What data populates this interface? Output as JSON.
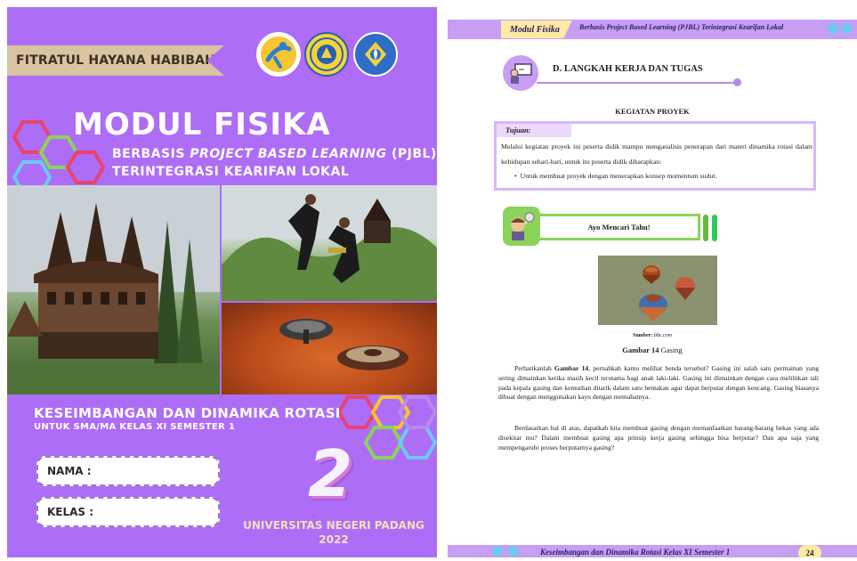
{
  "cover": {
    "author": "FITRATUL HAYANA HABIBAH",
    "title": "MODUL FISIKA",
    "subtitle_line1_prefix": "BERBASIS ",
    "subtitle_line1_italic": "PROJECT BASED LEARNING",
    "subtitle_line1_suffix": " (PJBL)",
    "subtitle_line2": "TERINTEGRASI KEARIFAN LOKAL",
    "topic": "KESEIMBANGAN DAN DINAMIKA ROTASI",
    "audience": "UNTUK SMA/MA KELAS XI SEMESTER 1",
    "nama_label": "NAMA :",
    "kelas_label": "KELAS :",
    "module_number": "2",
    "university": "UNIVERSITAS NEGERI PADANG",
    "year": "2022",
    "colors": {
      "background": "#ad6df6",
      "ribbon": "#d9c4a2",
      "university_text": "#f4dfc0"
    }
  },
  "page": {
    "header_tag": "Modul Fisika",
    "header_text": "Berbasis Project Based Learning (PJBL) Terintegrasi Kearifan Lokal",
    "section_title": "D.  LANGKAH KERJA DAN TUGAS",
    "activity_title": "KEGIATAN PROYEK",
    "tujuan_label": "Tujuan:",
    "tujuan_text": "Melalui kegiatan proyek ini peserta didik mampu menganalisis penerapan dari materi dinamika rotasi dalam kehidupan sehari-hari, untuk itu peserta didik diharapkan:",
    "tujuan_bullet": "Untuk membuat proyek dengan menerapkan konsep momentum sudut.",
    "ayo_title": "Ayo Mencari Tahu!",
    "source_label": "Sumber: ",
    "source_value": "bbc.com",
    "figure_label": "Gambar 14",
    "figure_caption": " Gasing",
    "para1_prefix": "Perhatikanlah ",
    "para1_bold": "Gambar 14",
    "para1_rest": ", pernahkah kamu melihat benda tersebut? Gasing ini salah satu permainan yang sering dimainkan ketika masih kecil terutama bagi anak laki-laki. Gasing ini dimainkan dengan cara melilitkan tali pada kepala gasing dan kemudian ditarik dalam satu hentakan agar dapat berputar dengan kencang. Gasing biasanya dibuat dengan menggunakan kayu dengan memahatnya.",
    "para2": "Berdasarkan hal di atas, dapatkah kita membuat gasing dengan memanfaatkan barang-barang bekas yang ada disekitar mu? Dalam membuat gasing apa prinsip kerja gasing sehingga bisa berputar? Dan apa saja yang mempengaruhi proses berputarnya gasing?",
    "footer_text": "Keseimbangan dan Dinamika Rotasi Kelas XI Semester 1",
    "page_number": "24",
    "colors": {
      "header_band": "#c79ef2",
      "header_tag": "#ffe9a6",
      "tujuan_border": "#d8b8f6",
      "ayo_green": "#8bd35a"
    }
  }
}
